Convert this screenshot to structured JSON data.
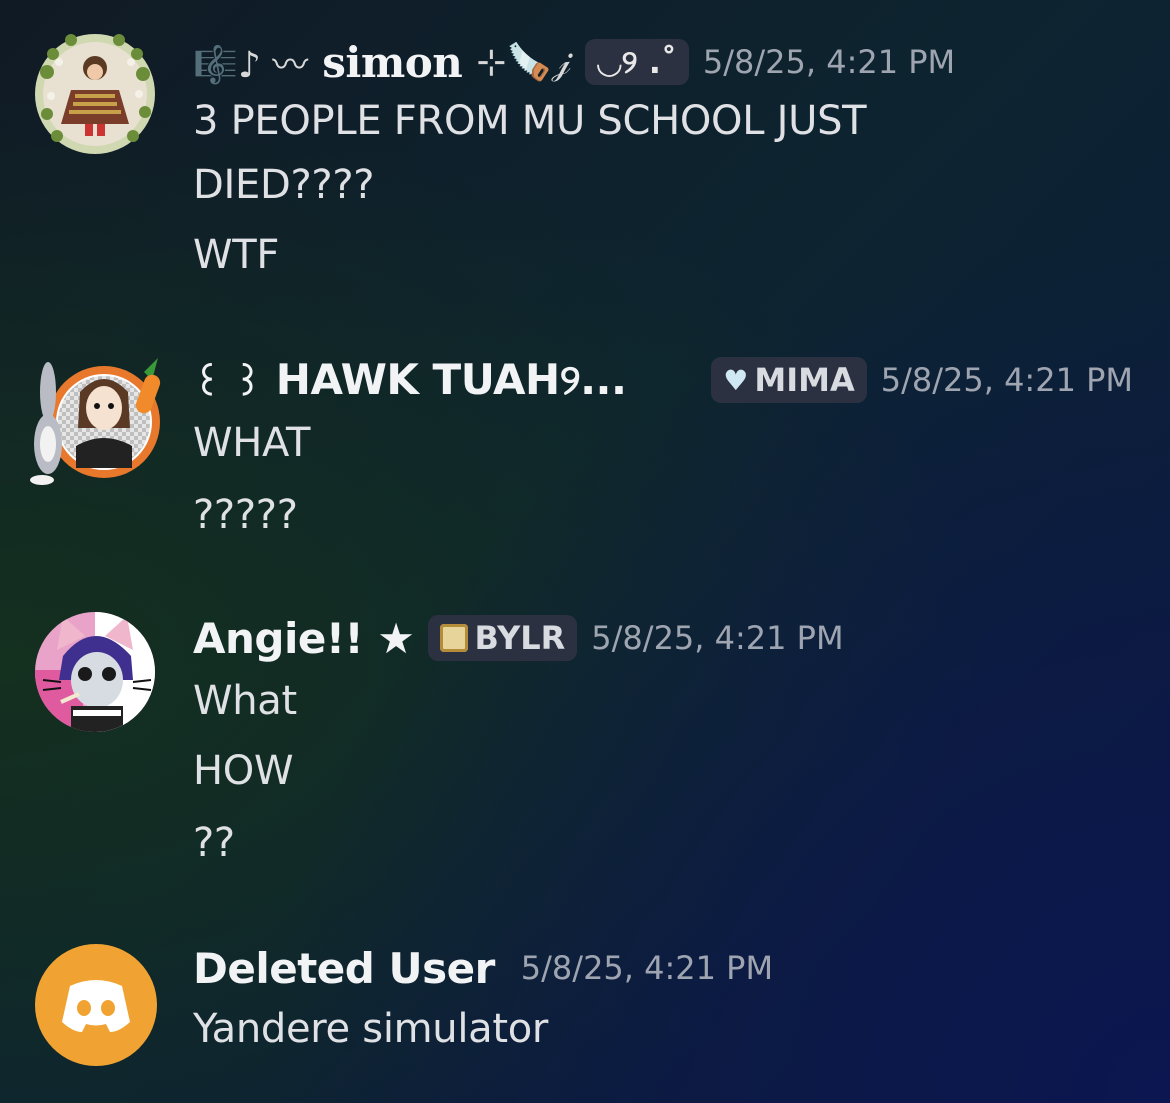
{
  "messages": [
    {
      "username": "simon",
      "username_prefix": "🎼♪ 〰",
      "username_suffix": "⊹🪚𝒿",
      "tag": "◡୨ .˚",
      "timestamp": "5/8/25, 4:21 PM",
      "lines": [
        "3 PEOPLE FROM MU SCHOOL JUST",
        "DIED????",
        "WTF"
      ],
      "avatar_icon": "doll-in-flower-wreath-icon"
    },
    {
      "username": "HAWK TUAH",
      "username_prefix": "꒰ ꒱",
      "username_suffix": "୨...",
      "tag": "MIMA",
      "tag_icon": "heart-icon",
      "timestamp": "5/8/25, 4:21 PM",
      "lines": [
        "WHAT",
        "?????"
      ],
      "avatar_icon": "bugs-bunny-portrait-icon"
    },
    {
      "username": "Angie!! ★",
      "tag": "BYLR",
      "tag_icon": "crest-icon",
      "timestamp": "5/8/25, 4:21 PM",
      "lines": [
        "What",
        "HOW",
        "??"
      ],
      "avatar_icon": "purple-hair-cat-ears-icon"
    },
    {
      "username": "Deleted User",
      "timestamp": "5/8/25, 4:21 PM",
      "lines": [
        "Yandere simulator"
      ],
      "avatar_icon": "discord-logo-icon",
      "avatar_color": "#f0a332"
    }
  ]
}
